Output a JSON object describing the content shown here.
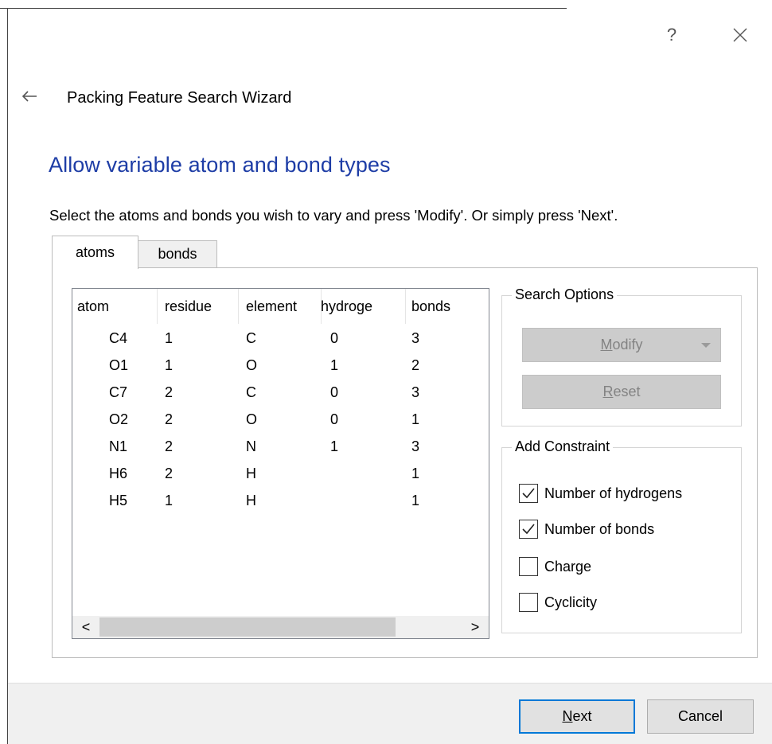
{
  "window": {
    "help_glyph": "?",
    "icons": {
      "help": "question-mark-icon",
      "close": "close-icon",
      "back": "back-arrow-icon"
    }
  },
  "wizard": {
    "title": "Packing Feature Search Wizard",
    "heading": "Allow variable atom and bond types",
    "instructions": "Select the atoms and bonds you wish to vary and press 'Modify'. Or simply press 'Next'."
  },
  "tabs": [
    {
      "label": "atoms",
      "active": true
    },
    {
      "label": "bonds",
      "active": false
    }
  ],
  "table": {
    "columns": [
      "atom",
      "residue",
      "element",
      "hydroge",
      "bonds"
    ],
    "rows": [
      [
        "C4",
        "1",
        "C",
        "0",
        "3"
      ],
      [
        "O1",
        "1",
        "O",
        "1",
        "2"
      ],
      [
        "C7",
        "2",
        "C",
        "0",
        "3"
      ],
      [
        "O2",
        "2",
        "O",
        "0",
        "1"
      ],
      [
        "N1",
        "2",
        "N",
        "1",
        "3"
      ],
      [
        "H6",
        "2",
        "H",
        "",
        "1"
      ],
      [
        "H5",
        "1",
        "H",
        "",
        "1"
      ]
    ],
    "scroll_left_glyph": "<",
    "scroll_right_glyph": ">"
  },
  "search_options": {
    "label": "Search Options",
    "modify": {
      "accel": "M",
      "rest": "odify",
      "enabled": false
    },
    "reset": {
      "accel": "R",
      "rest": "eset",
      "enabled": false
    }
  },
  "add_constraint": {
    "label": "Add Constraint",
    "items": [
      {
        "label": "Number of hydrogens",
        "checked": true
      },
      {
        "label": "Number of bonds",
        "checked": true
      },
      {
        "label": "Charge",
        "checked": false
      },
      {
        "label": "Cyclicity",
        "checked": false
      }
    ]
  },
  "footer": {
    "next": {
      "accel": "N",
      "rest": "ext"
    },
    "cancel": "Cancel"
  },
  "colors": {
    "heading": "#1e3da6",
    "focus_border": "#0078d7",
    "disabled_bg": "#cccccc"
  }
}
